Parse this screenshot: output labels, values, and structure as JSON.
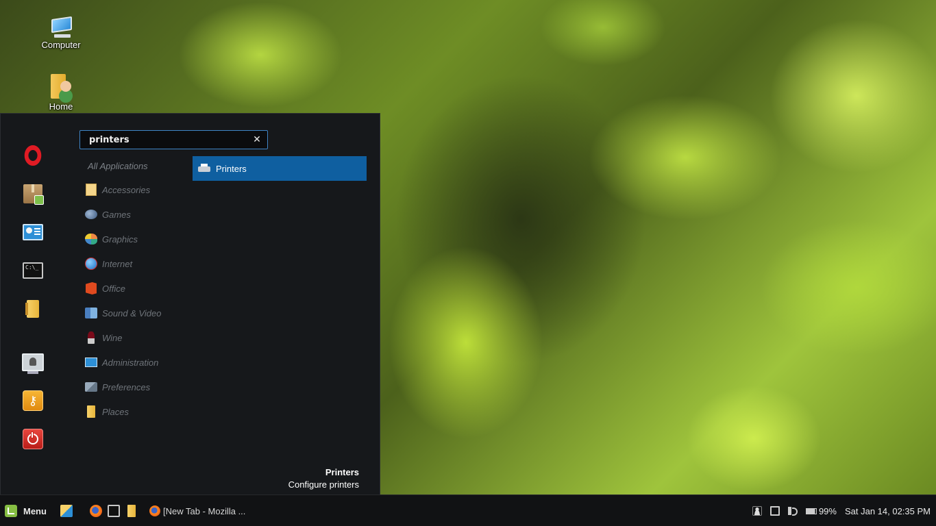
{
  "desktop": {
    "icons": [
      {
        "label": "Computer",
        "icon": "computer-icon"
      },
      {
        "label": "Home",
        "icon": "home-folder-icon"
      }
    ]
  },
  "menu": {
    "favorites": [
      {
        "name": "Opera",
        "icon": "opera-icon"
      },
      {
        "name": "Package Manager",
        "icon": "package-icon"
      },
      {
        "name": "Control Center",
        "icon": "control-center-icon"
      },
      {
        "name": "Terminal",
        "icon": "terminal-icon"
      },
      {
        "name": "Files",
        "icon": "folder-icon"
      },
      {
        "name": "Lock Screen",
        "icon": "lock-screen-icon"
      },
      {
        "name": "Logout",
        "icon": "keys-icon"
      },
      {
        "name": "Quit",
        "icon": "power-icon"
      }
    ],
    "search": {
      "value": "printers",
      "clear_glyph": "✕"
    },
    "categories_all": "All Applications",
    "categories": [
      {
        "label": "Accessories",
        "icon": "accessories-icon"
      },
      {
        "label": "Games",
        "icon": "games-icon"
      },
      {
        "label": "Graphics",
        "icon": "graphics-icon"
      },
      {
        "label": "Internet",
        "icon": "internet-icon"
      },
      {
        "label": "Office",
        "icon": "office-icon"
      },
      {
        "label": "Sound & Video",
        "icon": "sound-video-icon"
      },
      {
        "label": "Wine",
        "icon": "wine-icon"
      },
      {
        "label": "Administration",
        "icon": "administration-icon"
      },
      {
        "label": "Preferences",
        "icon": "preferences-icon"
      },
      {
        "label": "Places",
        "icon": "places-icon"
      }
    ],
    "results": [
      {
        "label": "Printers",
        "icon": "printer-icon",
        "selected": true
      }
    ],
    "description": {
      "title": "Printers",
      "text": "Configure printers"
    },
    "colors": {
      "selected_bg": "#0f5fa0",
      "search_border": "#3f85c6",
      "panel_bg": "#16181b"
    }
  },
  "taskbar": {
    "menu_label": "Menu",
    "launchers": [
      "show-desktop-icon",
      "firefox-icon",
      "terminal-icon",
      "files-icon"
    ],
    "window": {
      "title": "[New Tab - Mozilla ...",
      "icon": "firefox-icon"
    },
    "tray": {
      "battery": "99%",
      "clock": "Sat Jan 14, 02:35 PM",
      "icons": [
        "user-icon",
        "network-icon",
        "volume-icon",
        "battery-icon"
      ]
    }
  }
}
